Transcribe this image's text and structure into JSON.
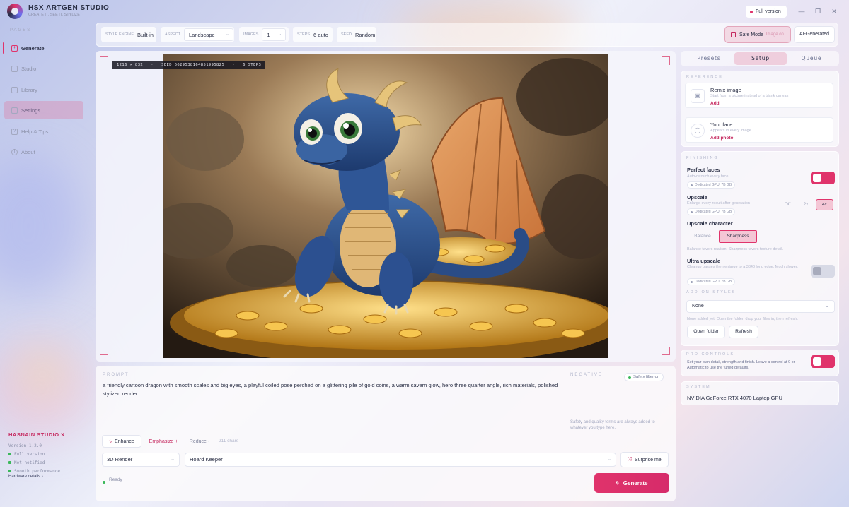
{
  "app": {
    "title": "HSX ARTGEN STUDIO",
    "subtitle": "CREATE IT. SEE IT. STYLIZE",
    "full_version_label": "Full version",
    "window_controls": [
      "minimize-icon",
      "restore-icon",
      "close-icon"
    ]
  },
  "sidebar": {
    "heading": "PAGES",
    "items": [
      {
        "label": "Generate",
        "icon": "generate-icon"
      },
      {
        "label": "Studio",
        "icon": "studio-icon"
      },
      {
        "label": "Library",
        "icon": "library-icon"
      },
      {
        "label": "Settings",
        "icon": "settings-icon"
      },
      {
        "label": "Help & Tips",
        "icon": "help-icon"
      },
      {
        "label": "About",
        "icon": "info-icon"
      }
    ],
    "brand": "HASNAIN STUDIO X",
    "version": "Version 1.2.0",
    "status_lines": [
      "Full version",
      "Not notified",
      "Smooth performance"
    ],
    "hardware_link": "Hardware details"
  },
  "toolbar": {
    "style_engine_label": "STYLE ENGINE",
    "style_engine_value": "Built-in",
    "aspect_label": "ASPECT",
    "aspect_value": "Landscape",
    "images_label": "IMAGES",
    "images_value": "1",
    "steps_label": "STEPS",
    "steps_value": "6 auto",
    "seed_label": "SEED",
    "seed_value": "Random",
    "safe_mode_label": "Safe Mode",
    "safe_mode_sub": "Image on",
    "ai_generated_label": "AI-Generated"
  },
  "canvas": {
    "meta_size": "1216 × 832",
    "meta_seed": "SEED 6629538164851995825",
    "meta_steps": "6 STEPS"
  },
  "prompt": {
    "label": "PROMPT",
    "negative_label": "NEGATIVE",
    "text": "a friendly cartoon dragon with smooth scales and big eyes, a playful coiled pose perched on a glittering pile of gold coins, a warm cavern glow, hero three quarter angle, rich materials, polished stylized render",
    "safety_badge": "Safety filter on",
    "negative_hint": "Safety and quality terms are always added to whatever you type here.",
    "enhance_label": "Enhance",
    "emphasize_label": "Emphasize +",
    "reduce_label": "Reduce -",
    "char_count": "211 chars",
    "style_select": "3D Render",
    "preset_select": "Hoard Keeper",
    "surprise_label": "Surprise me",
    "status": "Ready",
    "generate_label": "Generate"
  },
  "right_panel": {
    "tabs": [
      "Presets",
      "Setup",
      "Queue"
    ],
    "active_tab": "Setup",
    "reference_label": "REFERENCE",
    "remix_title": "Remix image",
    "remix_sub": "Start from a picture instead of a blank canvas",
    "remix_add": "Add",
    "face_title": "Your face",
    "face_sub": "Appears in every image",
    "face_add": "Add photo",
    "finishing_label": "FINISHING",
    "perfect_faces_title": "Perfect faces",
    "perfect_faces_sub": "Auto-retouch every face",
    "gpu_pill": "Dedicated GPU, 7B GB",
    "upscale_title": "Upscale",
    "upscale_sub": "Enlarge every result after generation",
    "upscale_options": [
      "Off",
      "2x",
      "4x"
    ],
    "upscale_selected": "4x",
    "upscale_char_title": "Upscale character",
    "upscale_char_options": [
      "Balance",
      "Sharpness"
    ],
    "upscale_char_selected": "Sharpness",
    "upscale_char_hint": "Balance favors realism. Sharpness favors texture detail.",
    "ultra_title": "Ultra upscale",
    "ultra_sub": "Cleanup passes then enlarge to a 3840 long edge. Much slower.",
    "addon_label": "ADD-ON STYLES",
    "addon_value": "None",
    "addon_hint": "None added yet. Open the folder, drop your files in, then refresh.",
    "open_folder_label": "Open folder",
    "refresh_label": "Refresh",
    "pro_label": "PRO CONTROLS",
    "pro_text": "Set your own detail, strength and finish. Leave a control at 0 or Automatic to use the tuned defaults.",
    "system_label": "SYSTEM",
    "gpu_name": "NVIDIA GeForce RTX 4070 Laptop GPU",
    "toggles": {
      "perfect_faces": true,
      "ultra_upscale": false,
      "pro_controls": true
    }
  },
  "colors": {
    "accent": "#e0336b",
    "success": "#3ab85a"
  }
}
